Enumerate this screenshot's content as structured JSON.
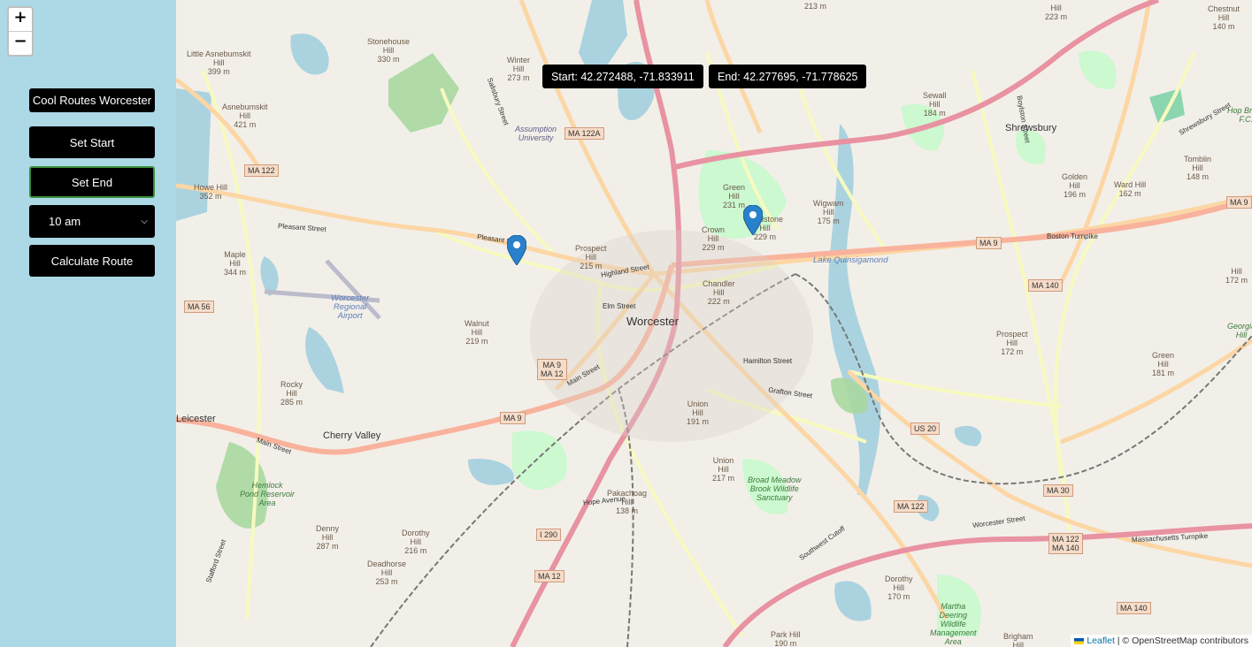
{
  "sidebar": {
    "title": "Cool Routes Worcester",
    "set_start": "Set Start",
    "set_end": "Set End",
    "time_select": "10 am",
    "calculate": "Calculate Route"
  },
  "zoom": {
    "in": "+",
    "out": "−"
  },
  "coords": {
    "start": "Start: 42.272488, -71.833911",
    "end": "End: 42.277695, -71.778625"
  },
  "map": {
    "city": "Worcester",
    "towns": [
      "Shrewsbury",
      "Cherry Valley",
      "Leicester"
    ],
    "hills": [
      {
        "name": "Stonehouse\nHill\n330 m"
      },
      {
        "name": "Little Asnebumskit\nHill\n399 m"
      },
      {
        "name": "Asnebumskit\nHill\n421 m"
      },
      {
        "name": "Winter\nHill\n273 m"
      },
      {
        "name": "Howe Hill\n352 m"
      },
      {
        "name": "Maple\nHill\n344 m"
      },
      {
        "name": "Prospect\nHill\n215 m"
      },
      {
        "name": "Green\nHill\n231 m"
      },
      {
        "name": "Crown\nHill\n229 m"
      },
      {
        "name": "Bradstone\nHill\n229 m"
      },
      {
        "name": "Wigwam\nHill\n175 m"
      },
      {
        "name": "Chandler\nHill\n222 m"
      },
      {
        "name": "Walnut\nHill\n219 m"
      },
      {
        "name": "Rocky\nHill\n285 m"
      },
      {
        "name": "Union\nHill\n191 m"
      },
      {
        "name": "Union\nHill\n217 m"
      },
      {
        "name": "Pakachoag\nHill\n138 m"
      },
      {
        "name": "Denny\nHill\n287 m"
      },
      {
        "name": "Dorothy\nHill\n216 m"
      },
      {
        "name": "Deadhorse\nHill\n253 m"
      },
      {
        "name": "Golden\nHill\n196 m"
      },
      {
        "name": "Ward Hill\n162 m"
      },
      {
        "name": "Tomblin\nHill\n148 m"
      },
      {
        "name": "Prospect\nHill\n172 m"
      },
      {
        "name": "Green\nHill\n181 m"
      },
      {
        "name": "Dorothy\nHill\n170 m"
      },
      {
        "name": "Sewall\nHill\n184 m"
      },
      {
        "name": "Brigham\nHill"
      },
      {
        "name": "Park Hill\n190 m"
      },
      {
        "name": "Chestnut\nHill\n140 m"
      },
      {
        "name": "Hill\n223 m"
      },
      {
        "name": "213 m"
      },
      {
        "name": "Hill\n172 m"
      }
    ],
    "places": [
      {
        "name": "Assumption\nUniversity"
      },
      {
        "name": "Worcester\nRegional\nAirport"
      },
      {
        "name": "Lake Quinsigamond"
      },
      {
        "name": "Broad Meadow\nBrook Wildlife\nSanctuary"
      },
      {
        "name": "Hemlock\nPond Reservoir\nArea"
      },
      {
        "name": "Martha\nDeering\nWildlife\nManagement\nArea"
      },
      {
        "name": "Hop Brook\nF.C."
      },
      {
        "name": "Georgia\nHill"
      }
    ],
    "shields": [
      "MA 122A",
      "MA 122",
      "MA 56",
      "MA 9\nMA 12",
      "MA 9",
      "MA 9",
      "MA 140",
      "US 20",
      "MA 122",
      "MA 30",
      "MA 122\nMA 140",
      "MA 140",
      "I 290",
      "MA 12",
      "MA 9"
    ],
    "roads": [
      "Pleasant Street",
      "Highland Street",
      "Elm Street",
      "Main Street",
      "Hamilton Street",
      "Grafton Street",
      "Boston Turnpike",
      "Hope Avenue",
      "Salisbury Street",
      "Pleasant Street",
      "Main Street",
      "Massachusetts Turnpike",
      "Worcester Street",
      "Southwest Cutoff",
      "Stafford Street",
      "Boylston Street",
      "Shrewsbury Street"
    ]
  },
  "attribution": {
    "leaflet": "Leaflet",
    "rest": " | © OpenStreetMap contributors"
  },
  "colors": {
    "sidebar": "#add8e6",
    "motorway": "#e892a2",
    "trunk": "#f9b29c",
    "primary": "#fcd6a4",
    "secondary": "#f7fabf",
    "water": "#aad3df",
    "park": "#c8facc",
    "marker": "#2a81cb"
  }
}
